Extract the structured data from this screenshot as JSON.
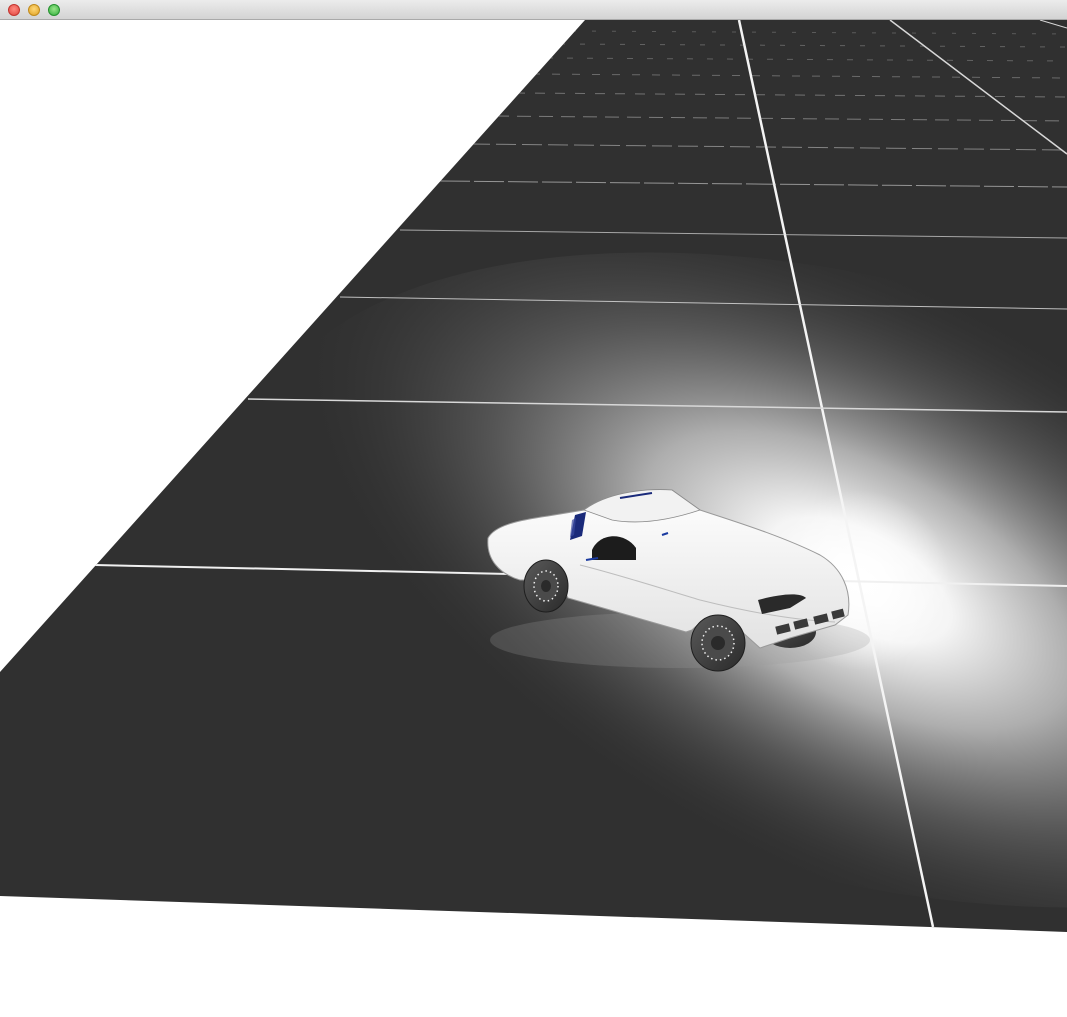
{
  "window": {
    "controls": [
      "close-button",
      "minimize-button",
      "zoom-button"
    ],
    "colors": {
      "close": "#e0443e",
      "minimize": "#dea123",
      "zoom": "#2fae3a"
    }
  },
  "scene": {
    "background": "#ffffff",
    "ground_color": "#303030",
    "grid_line_color": "#d8d8d8",
    "spotlight_color": "#ffffff",
    "car": {
      "body_color": "#f8f8f8",
      "window_tint": "#1a2a7a",
      "tire_color": "#3c3c3c",
      "rim_dots_color": "#f0f0f0"
    }
  }
}
